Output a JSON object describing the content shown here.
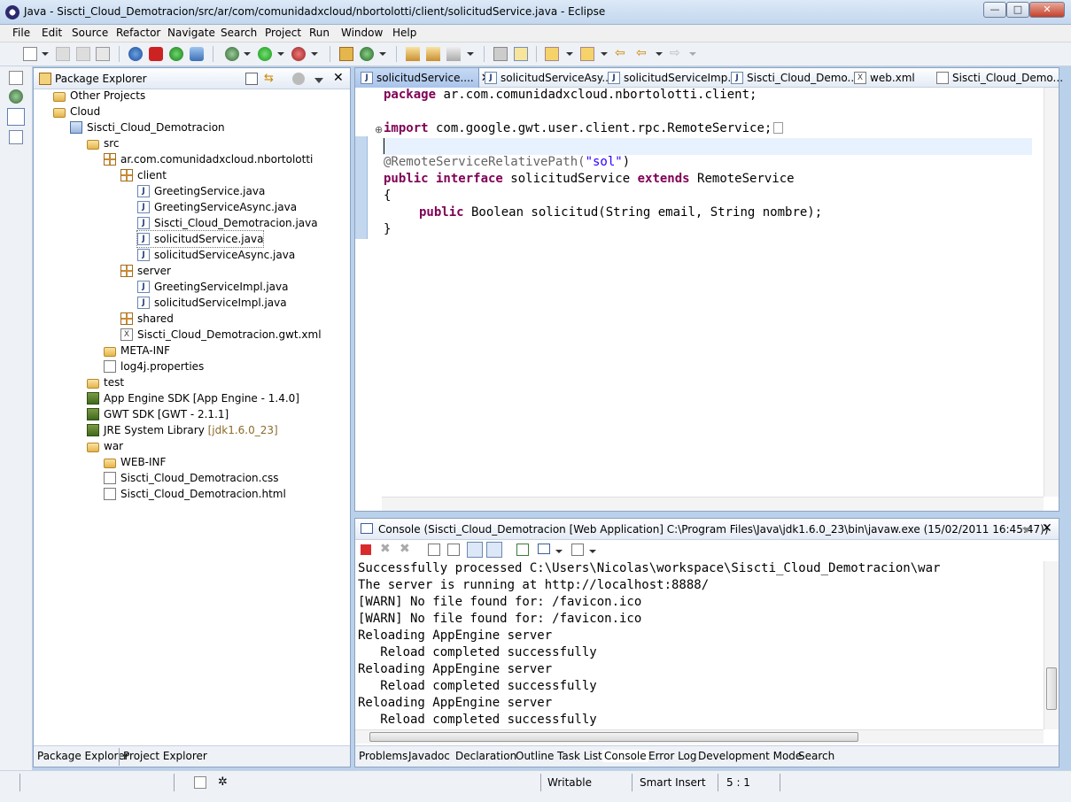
{
  "window": {
    "title": "Java - Siscti_Cloud_Demotracion/src/ar/com/comunidadxcloud/nbortolotti/client/solicitudService.java - Eclipse",
    "minimize": "—",
    "maximize": "□",
    "close": "✕"
  },
  "menu": [
    "File",
    "Edit",
    "Source",
    "Refactor",
    "Navigate",
    "Search",
    "Project",
    "Run",
    "Window",
    "Help"
  ],
  "package_explorer": {
    "title": "Package Explorer",
    "tree": [
      {
        "label": "Other Projects",
        "icon": "folder-icon"
      },
      {
        "label": "Cloud",
        "icon": "folder-icon"
      },
      {
        "label": "Siscti_Cloud_Demotracion",
        "icon": "project-icon"
      },
      {
        "label": "src",
        "icon": "package-folder-icon"
      },
      {
        "label": "ar.com.comunidadxcloud.nbortolotti",
        "icon": "package-icon"
      },
      {
        "label": "client",
        "icon": "package-icon"
      },
      {
        "label": "GreetingService.java",
        "icon": "java-file-icon"
      },
      {
        "label": "GreetingServiceAsync.java",
        "icon": "java-file-icon"
      },
      {
        "label": "Siscti_Cloud_Demotracion.java",
        "icon": "java-file-icon"
      },
      {
        "label": "solicitudService.java",
        "icon": "java-file-icon"
      },
      {
        "label": "solicitudServiceAsync.java",
        "icon": "java-file-icon"
      },
      {
        "label": "server",
        "icon": "package-icon"
      },
      {
        "label": "GreetingServiceImpl.java",
        "icon": "java-file-icon"
      },
      {
        "label": "solicitudServiceImpl.java",
        "icon": "java-file-icon"
      },
      {
        "label": "shared",
        "icon": "package-icon"
      },
      {
        "label": "Siscti_Cloud_Demotracion.gwt.xml",
        "icon": "xml-file-icon"
      },
      {
        "label": "META-INF",
        "icon": "folder-icon"
      },
      {
        "label": "log4j.properties",
        "icon": "properties-file-icon"
      },
      {
        "label": "test",
        "icon": "package-folder-icon"
      },
      {
        "label": "App Engine SDK [App Engine - 1.4.0]",
        "icon": "library-icon"
      },
      {
        "label": "GWT SDK [GWT - 2.1.1]",
        "icon": "library-icon"
      },
      {
        "label": "JRE System Library",
        "suffix": "[jdk1.6.0_23]",
        "icon": "library-icon"
      },
      {
        "label": "war",
        "icon": "folder-icon"
      },
      {
        "label": "WEB-INF",
        "icon": "folder-icon"
      },
      {
        "label": "Siscti_Cloud_Demotracion.css",
        "icon": "file-icon"
      },
      {
        "label": "Siscti_Cloud_Demotracion.html",
        "icon": "file-icon"
      }
    ],
    "bottom_tabs": [
      "Package Explorer",
      "Project Explorer"
    ]
  },
  "editor": {
    "tabs": [
      "solicitudService....",
      "solicitudServiceAsy...",
      "solicitudServiceImp...",
      "Siscti_Cloud_Demo...",
      "web.xml",
      "Siscti_Cloud_Demo..."
    ],
    "code": {
      "package_kw": "package",
      "package_name": " ar.com.comunidadxcloud.nbortolotti.client;",
      "import_kw": "import",
      "import_name": " com.google.gwt.user.client.rpc.RemoteService;",
      "annotation": "@RemoteServiceRelativePath(",
      "annotation_str": "\"sol\"",
      "annotation_end": ")",
      "public_kw": "public",
      "interface_kw": " interface",
      "class_name": " solicitudService ",
      "extends_kw": "extends",
      "super_name": " RemoteService",
      "open_brace": "{",
      "method_public": "public",
      "method_rest": " Boolean solicitud(String email, String nombre);",
      "close_brace": "}"
    }
  },
  "console": {
    "title": "Console (Siscti_Cloud_Demotracion [Web Application] C:\\Program Files\\Java\\jdk1.6.0_23\\bin\\javaw.exe (15/02/2011 16:45:47))",
    "lines": [
      "Successfully processed C:\\Users\\Nicolas\\workspace\\Siscti_Cloud_Demotracion\\war",
      "The server is running at http://localhost:8888/",
      "[WARN] No file found for: /favicon.ico",
      "[WARN] No file found for: /favicon.ico",
      "Reloading AppEngine server",
      "   Reload completed successfully",
      "Reloading AppEngine server",
      "   Reload completed successfully",
      "Reloading AppEngine server",
      "   Reload completed successfully"
    ],
    "bottom_tabs": [
      "Problems",
      "Javadoc",
      "Declaration",
      "Outline",
      "Task List",
      "Console",
      "Error Log",
      "Development Mode",
      "Search"
    ]
  },
  "status": {
    "writable": "Writable",
    "insert_mode": "Smart Insert",
    "position": "5 : 1"
  },
  "colors": {
    "keyword": "#7f0055",
    "annotation": "#646464",
    "string": "#2a00ff"
  }
}
